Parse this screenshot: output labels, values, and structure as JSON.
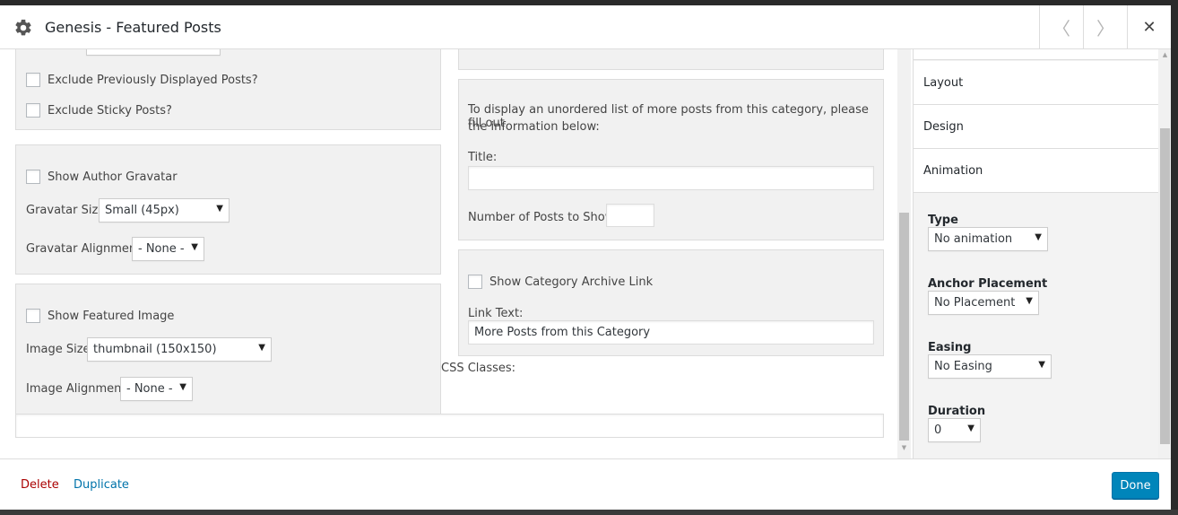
{
  "header": {
    "title": "Genesis - Featured Posts",
    "prev_icon": "chevron-left-icon",
    "next_icon": "chevron-right-icon",
    "close_icon": "close-icon",
    "prev_glyph": "〈",
    "next_glyph": "〉",
    "close_glyph": "✕"
  },
  "left_column": {
    "posts_panel": {
      "exclude_previous": "Exclude Previously Displayed Posts?",
      "exclude_sticky": "Exclude Sticky Posts?"
    },
    "gravatar_panel": {
      "show_gravatar": "Show Author Gravatar",
      "size_label": "Gravatar Size:",
      "size_value": "Small (45px)",
      "alignment_label": "Gravatar Alignment:",
      "alignment_value": "- None -"
    },
    "image_panel": {
      "show_image": "Show Featured Image",
      "size_label": "Image Size:",
      "size_value": "thumbnail (150x150)",
      "alignment_label": "Image Alignment:",
      "alignment_value": "- None -"
    }
  },
  "right_column": {
    "more_posts_panel": {
      "intro_line1": "To display an unordered list of more posts from this category, please fill out",
      "intro_line2": "the information below:",
      "title_label": "Title:",
      "title_value": "",
      "count_label": "Number of Posts to Show:",
      "count_value": ""
    },
    "archive_panel": {
      "show_archive": "Show Category Archive Link",
      "link_text_label": "Link Text:",
      "link_text_value": "More Posts from this Category"
    }
  },
  "css_classes": {
    "label": "CSS Classes:",
    "value": ""
  },
  "sidebar": {
    "tabs": [
      "Layout",
      "Design",
      "Animation"
    ],
    "type_label": "Type",
    "type_value": "No animation",
    "anchor_label": "Anchor Placement",
    "anchor_value": "No Placement",
    "easing_label": "Easing",
    "easing_value": "No Easing",
    "duration_label": "Duration",
    "duration_value": "0"
  },
  "footer": {
    "delete": "Delete",
    "duplicate": "Duplicate",
    "done": "Done"
  },
  "colors": {
    "primary": "#0085ba",
    "delete": "#a00",
    "link": "#0073aa"
  }
}
